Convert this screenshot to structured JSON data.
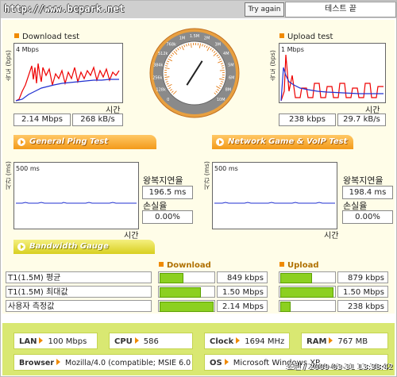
{
  "header": {
    "site": "http://www.bcpark.net",
    "try_again": "Try again",
    "status": "테스트 끝"
  },
  "download": {
    "title": "Download test",
    "unit_axis": "속도 (bps)",
    "scale": "4 Mbps",
    "time_label": "시간",
    "speed": "2.14 Mbps",
    "rate": "268 kB/s"
  },
  "upload": {
    "title": "Upload test",
    "unit_axis": "속도 (bps)",
    "scale": "1 Mbps",
    "time_label": "시간",
    "speed": "238 kbps",
    "rate": "29.7 kB/s"
  },
  "gauge": {
    "ticks": [
      "0",
      "128k",
      "256k",
      "384k",
      "512k",
      "768k",
      "1M",
      "1.5M",
      "2M",
      "3M",
      "4M",
      "5M",
      "6M",
      "8M",
      "10M"
    ],
    "needle_fraction": 0.62
  },
  "sections": {
    "ping": "General Ping Test",
    "game": "Network Game & VoIP Test",
    "bandwidth": "Bandwidth Gauge"
  },
  "ping": {
    "unit_axis": "시간 (ms)",
    "scale": "500 ms",
    "time_label": "시간",
    "rtt_label": "왕복지연율",
    "rtt": "196.5 ms",
    "loss_label": "손실율",
    "loss": "0.00%"
  },
  "game": {
    "unit_axis": "시간 (ms)",
    "scale": "500 ms",
    "time_label": "시간",
    "rtt_label": "왕복지연율",
    "rtt": "198.4 ms",
    "loss_label": "손실율",
    "loss": "0.00%"
  },
  "bandwidth": {
    "download_header": "Download",
    "upload_header": "Upload",
    "rows": [
      {
        "label": "T1(1.5M) 평균",
        "down": "849 kbps",
        "down_fill": 0.42,
        "up": "879 kbps",
        "up_fill": 0.58
      },
      {
        "label": "T1(1.5M) 최대값",
        "down": "1.50 Mbps",
        "down_fill": 0.75,
        "up": "1.50 Mbps",
        "up_fill": 0.99
      },
      {
        "label": "사용자 측정값",
        "down": "2.14 Mbps",
        "down_fill": 1.0,
        "up": "238 kbps",
        "up_fill": 0.16
      }
    ]
  },
  "info": {
    "lan_k": "LAN",
    "lan_v": "100 Mbps",
    "cpu_k": "CPU",
    "cpu_v": "586",
    "clock_k": "Clock",
    "clock_v": "1694 MHz",
    "ram_k": "RAM",
    "ram_v": "767 MB",
    "browser_k": "Browser",
    "browser_v": "Mozilla/4.0 (compatible; MSIE 6.0",
    "os_k": "OS",
    "os_v": "Microsoft Windows XP",
    "timestamp": "초린 / 2009-03-31 13:38:42"
  },
  "colors": {
    "accent": "#f08a00",
    "bar": "#8cd020",
    "info_bg": "#d9e872"
  }
}
